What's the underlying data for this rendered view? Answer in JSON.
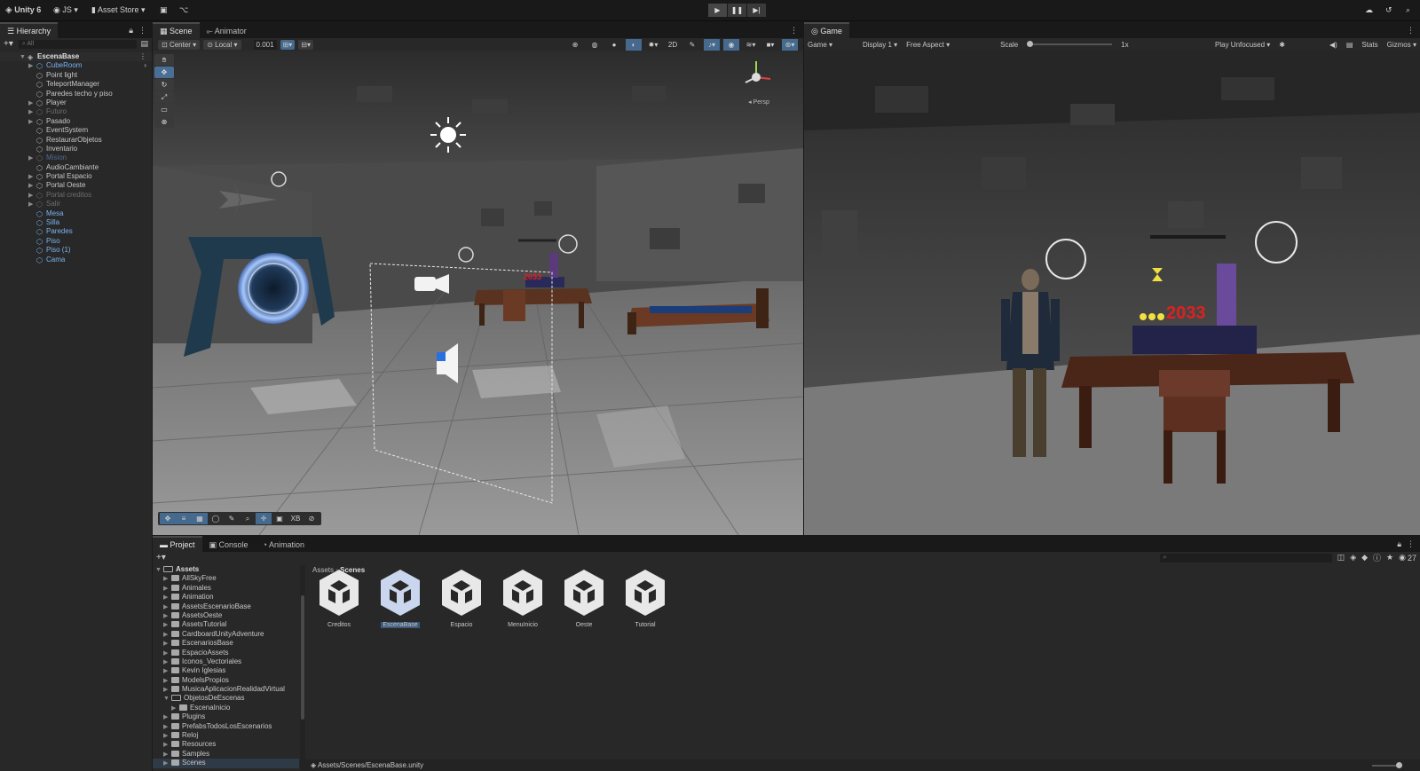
{
  "toolbar": {
    "app": "Unity 6",
    "account": "JS",
    "asset_store": "Asset Store"
  },
  "hierarchy": {
    "tab": "Hierarchy",
    "search_placeholder": "All",
    "scene": "EscenaBase",
    "items": [
      {
        "label": "CubeRoom",
        "style": "blue",
        "arrow": true
      },
      {
        "label": "Point light",
        "style": "normal",
        "arrow": false
      },
      {
        "label": "TeleportManager",
        "style": "normal",
        "arrow": false
      },
      {
        "label": "Paredes techo y piso",
        "style": "normal",
        "arrow": false
      },
      {
        "label": "Player",
        "style": "normal",
        "arrow": true
      },
      {
        "label": "Futuro",
        "style": "dim",
        "arrow": true
      },
      {
        "label": "Pasado",
        "style": "normal",
        "arrow": true
      },
      {
        "label": "EventSystem",
        "style": "normal",
        "arrow": false
      },
      {
        "label": "RestaurarObjetos",
        "style": "normal",
        "arrow": false
      },
      {
        "label": "Inventario",
        "style": "normal",
        "arrow": false
      },
      {
        "label": "Mision",
        "style": "dimblue",
        "arrow": true
      },
      {
        "label": "AudioCambiante",
        "style": "normal",
        "arrow": false
      },
      {
        "label": "Portal Espacio",
        "style": "normal",
        "arrow": true
      },
      {
        "label": "Portal Oeste",
        "style": "normal",
        "arrow": true
      },
      {
        "label": "Portal creditos",
        "style": "dim",
        "arrow": true
      },
      {
        "label": "Salir",
        "style": "dim",
        "arrow": true
      },
      {
        "label": "Mesa",
        "style": "blue",
        "arrow": false
      },
      {
        "label": "Silla",
        "style": "blue",
        "arrow": false
      },
      {
        "label": "Paredes",
        "style": "blue",
        "arrow": false
      },
      {
        "label": "Piso",
        "style": "blue",
        "arrow": false
      },
      {
        "label": "Piso (1)",
        "style": "blue",
        "arrow": false
      },
      {
        "label": "Cama",
        "style": "blue",
        "arrow": false
      }
    ]
  },
  "scene_view": {
    "tabs": [
      "Scene",
      "Animator"
    ],
    "pivot": "Center",
    "space": "Local",
    "snap_value": "0.001",
    "persp_label": "Persp",
    "bottom_tool_label": "XB"
  },
  "game_view": {
    "tab": "Game",
    "mode": "Game",
    "display": "Display 1",
    "aspect": "Free Aspect",
    "scale_label": "Scale",
    "scale_value": "1x",
    "play_mode": "Play Unfocused",
    "stats": "Stats",
    "gizmos": "Gizmos",
    "score_text": "2033"
  },
  "scene_text": {
    "score": "2033"
  },
  "project": {
    "tabs": [
      "Project",
      "Console",
      "Animation"
    ],
    "root": "Assets",
    "folders": [
      {
        "label": "AllSkyFree",
        "indent": 1,
        "open": false
      },
      {
        "label": "Animales",
        "indent": 1,
        "open": false
      },
      {
        "label": "Animation",
        "indent": 1,
        "open": false
      },
      {
        "label": "AssetsEscenarioBase",
        "indent": 1,
        "open": false
      },
      {
        "label": "AssetsOeste",
        "indent": 1,
        "open": false
      },
      {
        "label": "AssetsTutorial",
        "indent": 1,
        "open": false
      },
      {
        "label": "CardboardUnityAdventure",
        "indent": 1,
        "open": false
      },
      {
        "label": "EscenariosBase",
        "indent": 1,
        "open": false
      },
      {
        "label": "EspacioAssets",
        "indent": 1,
        "open": false
      },
      {
        "label": "Iconos_Vectoriales",
        "indent": 1,
        "open": false
      },
      {
        "label": "Kevin Iglesias",
        "indent": 1,
        "open": false
      },
      {
        "label": "ModelsPropios",
        "indent": 1,
        "open": false
      },
      {
        "label": "MusicaAplicacionRealidadVirtual",
        "indent": 1,
        "open": false
      },
      {
        "label": "ObjetosDeEscenas",
        "indent": 1,
        "open": true
      },
      {
        "label": "EscenaInicio",
        "indent": 2,
        "open": false
      },
      {
        "label": "Plugins",
        "indent": 1,
        "open": false
      },
      {
        "label": "PrefabsTodosLosEscenarios",
        "indent": 1,
        "open": false
      },
      {
        "label": "Reloj",
        "indent": 1,
        "open": false
      },
      {
        "label": "Resources",
        "indent": 1,
        "open": false
      },
      {
        "label": "Samples",
        "indent": 1,
        "open": false
      },
      {
        "label": "Scenes",
        "indent": 1,
        "open": false
      }
    ],
    "breadcrumb": [
      "Assets",
      "Scenes"
    ],
    "assets": [
      "Creditos",
      "EscenaBase",
      "Espacio",
      "MenuInicio",
      "Oeste",
      "Tutorial"
    ],
    "selected_asset": "EscenaBase",
    "status_path": "Assets/Scenes/EscenaBase.unity",
    "hidden_count": "27"
  },
  "colors": {
    "selection": "#3d5a7a",
    "accent_blue": "#7ab3f0",
    "score_red": "#e02020"
  }
}
